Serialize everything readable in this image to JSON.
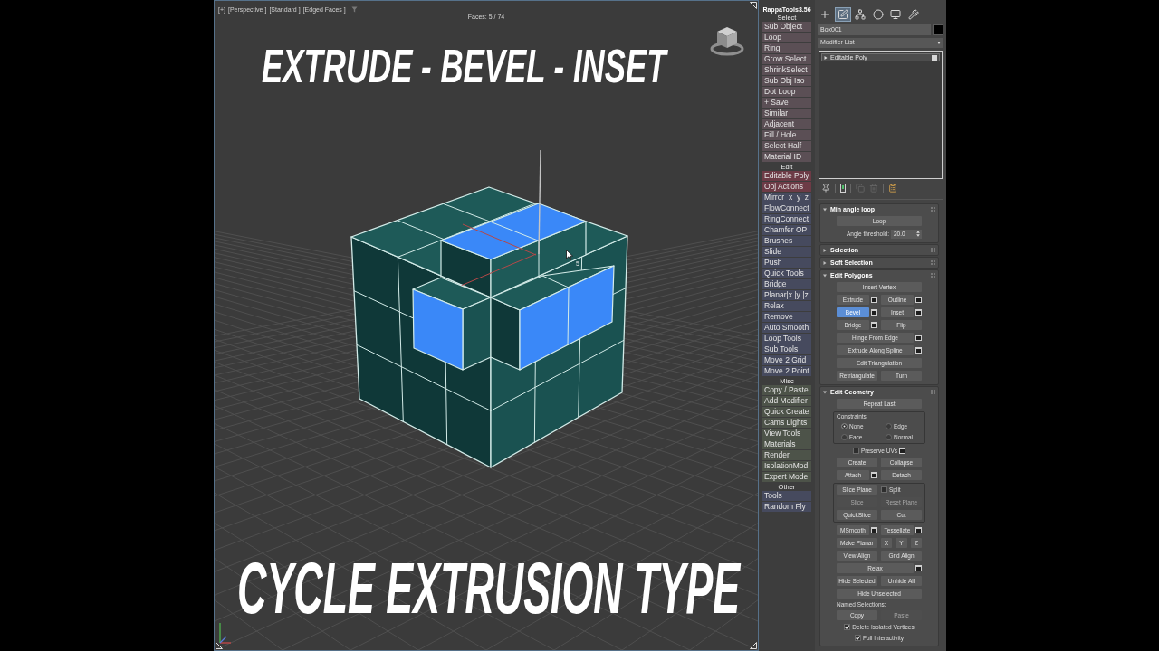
{
  "viewport": {
    "view_labels": [
      "[+]",
      "[Perspective ]",
      "[Standard ]",
      "[Edged Faces ]"
    ],
    "face_count": "Faces: 5 / 74",
    "headline": "EXTRUDE - BEVEL - INSET",
    "caption": "CYCLE EXTRUSION TYPE",
    "cursor_hint": "5"
  },
  "rappa_tools": {
    "title": "RappaTools3.56",
    "sections": [
      {
        "title": "Select",
        "buttons": [
          {
            "label": "Sub Object",
            "color": "#5b4f55"
          },
          {
            "label": "Loop",
            "color": "#5b4f55"
          },
          {
            "label": "Ring",
            "color": "#5b4f55"
          },
          {
            "label": "Grow Select",
            "color": "#5b4f55"
          },
          {
            "label": "ShrinkSelect",
            "color": "#5b4f55"
          },
          {
            "label": "Sub Obj Iso",
            "color": "#5b4f55"
          },
          {
            "label": "Dot Loop",
            "color": "#5b4f55"
          },
          {
            "label": "+ Save",
            "color": "#5b4f55"
          },
          {
            "label": "Similar",
            "color": "#5b4f55"
          },
          {
            "label": "Adjacent",
            "color": "#5b4f55"
          },
          {
            "label": "Fill / Hole",
            "color": "#5b4f55"
          },
          {
            "label": "Select Half",
            "color": "#5b4f55"
          },
          {
            "label": "Material ID",
            "color": "#5b4f55"
          }
        ]
      },
      {
        "title": "Edit",
        "buttons": [
          {
            "label": "Editable Poly",
            "color": "#6d3b46"
          },
          {
            "label": "Obj Actions",
            "color": "#6d3b46"
          },
          {
            "label": "Mirror  x  y  z",
            "color": "#464a5e"
          },
          {
            "label": "FlowConnect",
            "color": "#464a5e"
          },
          {
            "label": "RingConnect",
            "color": "#464a5e"
          },
          {
            "label": "Chamfer OP",
            "color": "#464a5e"
          },
          {
            "label": "Brushes",
            "color": "#464a5e"
          },
          {
            "label": "Slide",
            "color": "#464a5e"
          },
          {
            "label": "Push",
            "color": "#464a5e"
          },
          {
            "label": "Quick Tools",
            "color": "#464a5e"
          },
          {
            "label": "Bridge",
            "color": "#464a5e"
          },
          {
            "label": "Planar|x |y |z",
            "color": "#464a5e"
          },
          {
            "label": "Relax",
            "color": "#464a5e"
          },
          {
            "label": "Remove",
            "color": "#464a5e"
          },
          {
            "label": "Auto Smooth",
            "color": "#464a5e"
          },
          {
            "label": "Loop Tools",
            "color": "#464a5e"
          },
          {
            "label": "Sub Tools",
            "color": "#464a5e"
          },
          {
            "label": "Move 2 Grid",
            "color": "#464a5e"
          },
          {
            "label": "Move 2 Point",
            "color": "#464a5e"
          }
        ]
      },
      {
        "title": "Misc",
        "buttons": [
          {
            "label": "Copy / Paste",
            "color": "#4d5349"
          },
          {
            "label": "Add Modifier",
            "color": "#4d5349"
          },
          {
            "label": "Quick Create",
            "color": "#4d5349"
          },
          {
            "label": "Cams Lights",
            "color": "#4d5349"
          },
          {
            "label": "View Tools",
            "color": "#4d5349"
          },
          {
            "label": "Materials",
            "color": "#4d5349"
          },
          {
            "label": "Render",
            "color": "#4d5349"
          },
          {
            "label": "IsolationMod",
            "color": "#4d5349"
          },
          {
            "label": "Expert Mode",
            "color": "#4d5349"
          }
        ]
      },
      {
        "title": "Other",
        "buttons": [
          {
            "label": "Tools",
            "color": "#464a5e"
          },
          {
            "label": "Random Fly",
            "color": "#464a5e"
          }
        ]
      }
    ]
  },
  "command_panel": {
    "tabs": [
      {
        "kind": "create",
        "selected": false
      },
      {
        "kind": "modify",
        "selected": true
      },
      {
        "kind": "hierarchy",
        "selected": false
      },
      {
        "kind": "motion",
        "selected": false
      },
      {
        "kind": "display",
        "selected": false
      },
      {
        "kind": "utilities",
        "selected": false
      }
    ],
    "object_name": "Box001",
    "modifier_list": "Modifier List",
    "stack": [
      {
        "label": "Editable Poly",
        "selected": true,
        "expanded": false,
        "on": true
      }
    ],
    "stack_tools": [
      {
        "kind": "pin",
        "disabled": false
      },
      {
        "kind": "show_end",
        "disabled": false
      },
      {
        "kind": "make_unique",
        "disabled": true
      },
      {
        "kind": "remove",
        "disabled": true
      },
      {
        "kind": "configure",
        "disabled": false
      }
    ],
    "rollouts": [
      {
        "title": "Min angle loop",
        "expanded": true,
        "rows": [
          {
            "kind": "row",
            "controls": [
              {
                "kind": "button",
                "label": "Loop",
                "selected": false,
                "disabled": false
              }
            ]
          },
          {
            "kind": "row",
            "controls": [
              {
                "kind": "spinner",
                "label": "Angle threshold:",
                "value": "20.0"
              }
            ]
          }
        ]
      },
      {
        "title": "Selection",
        "expanded": false
      },
      {
        "title": "Soft Selection",
        "expanded": false
      },
      {
        "title": "Edit Polygons",
        "expanded": true,
        "rows": [
          {
            "kind": "row",
            "controls": [
              {
                "kind": "button",
                "label": "Insert Vertex",
                "selected": false,
                "disabled": false
              }
            ]
          },
          {
            "kind": "row",
            "controls": [
              {
                "kind": "button",
                "label": "Extrude",
                "selected": false,
                "disabled": false
              },
              {
                "kind": "settings"
              },
              {
                "kind": "button",
                "label": "Outline",
                "selected": false,
                "disabled": false
              },
              {
                "kind": "settings"
              }
            ]
          },
          {
            "kind": "row",
            "controls": [
              {
                "kind": "button",
                "label": "Bevel",
                "selected": true,
                "disabled": false
              },
              {
                "kind": "settings"
              },
              {
                "kind": "button",
                "label": "Inset",
                "selected": false,
                "disabled": false
              },
              {
                "kind": "settings"
              }
            ]
          },
          {
            "kind": "row",
            "controls": [
              {
                "kind": "button",
                "label": "Bridge",
                "selected": false,
                "disabled": false
              },
              {
                "kind": "settings"
              },
              {
                "kind": "button",
                "label": "Flip",
                "selected": false,
                "disabled": false
              }
            ]
          },
          {
            "kind": "row",
            "controls": [
              {
                "kind": "button",
                "label": "Hinge From Edge",
                "selected": false,
                "disabled": false
              },
              {
                "kind": "settings"
              }
            ]
          },
          {
            "kind": "row",
            "controls": [
              {
                "kind": "button",
                "label": "Extrude Along Spline",
                "selected": false,
                "disabled": false
              },
              {
                "kind": "settings"
              }
            ]
          },
          {
            "kind": "row",
            "controls": [
              {
                "kind": "button",
                "label": "Edit Triangulation",
                "selected": false,
                "disabled": false
              }
            ]
          },
          {
            "kind": "row",
            "controls": [
              {
                "kind": "button",
                "label": "Retriangulate",
                "selected": false,
                "disabled": false
              },
              {
                "kind": "button",
                "label": "Turn",
                "selected": false,
                "disabled": false
              }
            ]
          }
        ]
      },
      {
        "title": "Edit Geometry",
        "expanded": true,
        "rows": [
          {
            "kind": "row",
            "controls": [
              {
                "kind": "button",
                "label": "Repeat Last",
                "selected": false,
                "disabled": false
              }
            ]
          },
          {
            "kind": "group",
            "title": "Constraints",
            "rows": [
              {
                "kind": "row",
                "controls": [
                  {
                    "kind": "radio",
                    "label": "None",
                    "selected": true
                  },
                  {
                    "kind": "radio",
                    "label": "Edge",
                    "selected": false
                  }
                ]
              },
              {
                "kind": "row",
                "controls": [
                  {
                    "kind": "radio",
                    "label": "Face",
                    "selected": false
                  },
                  {
                    "kind": "radio",
                    "label": "Normal",
                    "selected": false
                  }
                ]
              }
            ]
          },
          {
            "kind": "row",
            "controls": [
              {
                "kind": "checkbox",
                "label": "Preserve UVs",
                "checked": false
              },
              {
                "kind": "settings"
              }
            ]
          },
          {
            "kind": "row",
            "controls": [
              {
                "kind": "button",
                "label": "Create",
                "selected": false,
                "disabled": false
              },
              {
                "kind": "button",
                "label": "Collapse",
                "selected": false,
                "disabled": false
              }
            ]
          },
          {
            "kind": "row",
            "controls": [
              {
                "kind": "button",
                "label": "Attach",
                "selected": false,
                "disabled": false
              },
              {
                "kind": "settings"
              },
              {
                "kind": "button",
                "label": "Detach",
                "selected": false,
                "disabled": false
              }
            ]
          },
          {
            "kind": "group",
            "rows": [
              {
                "kind": "row",
                "controls": [
                  {
                    "kind": "button",
                    "label": "Slice Plane",
                    "selected": false,
                    "disabled": false
                  },
                  {
                    "kind": "checkbox",
                    "label": "Split",
                    "checked": false
                  }
                ]
              },
              {
                "kind": "row",
                "controls": [
                  {
                    "kind": "button",
                    "label": "Slice",
                    "selected": false,
                    "disabled": true
                  },
                  {
                    "kind": "button",
                    "label": "Reset Plane",
                    "selected": false,
                    "disabled": true
                  }
                ]
              },
              {
                "kind": "row",
                "controls": [
                  {
                    "kind": "button",
                    "label": "QuickSlice",
                    "selected": false,
                    "disabled": false
                  },
                  {
                    "kind": "button",
                    "label": "Cut",
                    "selected": false,
                    "disabled": false
                  }
                ]
              }
            ]
          },
          {
            "kind": "row",
            "controls": [
              {
                "kind": "button",
                "label": "MSmooth",
                "selected": false,
                "disabled": false
              },
              {
                "kind": "settings"
              },
              {
                "kind": "button",
                "label": "Tessellate",
                "selected": false,
                "disabled": false
              },
              {
                "kind": "settings"
              }
            ]
          },
          {
            "kind": "row",
            "controls": [
              {
                "kind": "button",
                "label": "Make Planar",
                "selected": false,
                "disabled": false
              },
              {
                "kind": "button",
                "label": "X",
                "selected": false,
                "disabled": false
              },
              {
                "kind": "button",
                "label": "Y",
                "selected": false,
                "disabled": false
              },
              {
                "kind": "button",
                "label": "Z",
                "selected": false,
                "disabled": false
              }
            ]
          },
          {
            "kind": "row",
            "controls": [
              {
                "kind": "button",
                "label": "View Align",
                "selected": false,
                "disabled": false
              },
              {
                "kind": "button",
                "label": "Grid Align",
                "selected": false,
                "disabled": false
              }
            ]
          },
          {
            "kind": "row",
            "controls": [
              {
                "kind": "button",
                "label": "Relax",
                "selected": false,
                "disabled": false
              },
              {
                "kind": "settings"
              }
            ]
          },
          {
            "kind": "row",
            "controls": [
              {
                "kind": "button",
                "label": "Hide Selected",
                "selected": false,
                "disabled": false
              },
              {
                "kind": "button",
                "label": "Unhide All",
                "selected": false,
                "disabled": false
              }
            ]
          },
          {
            "kind": "row",
            "controls": [
              {
                "kind": "button",
                "label": "Hide Unselected",
                "selected": false,
                "disabled": false
              }
            ]
          },
          {
            "kind": "row",
            "controls": [
              {
                "kind": "label",
                "label": "Named Selections:"
              }
            ]
          },
          {
            "kind": "row",
            "controls": [
              {
                "kind": "button",
                "label": "Copy",
                "selected": false,
                "disabled": false
              },
              {
                "kind": "button",
                "label": "Paste",
                "selected": false,
                "disabled": true
              }
            ]
          },
          {
            "kind": "row",
            "controls": [
              {
                "kind": "checkbox",
                "label": "Delete Isolated Vertices",
                "checked": true
              }
            ]
          },
          {
            "kind": "row",
            "controls": [
              {
                "kind": "checkbox",
                "label": "Full Interactivity",
                "checked": true
              }
            ]
          }
        ]
      }
    ]
  }
}
